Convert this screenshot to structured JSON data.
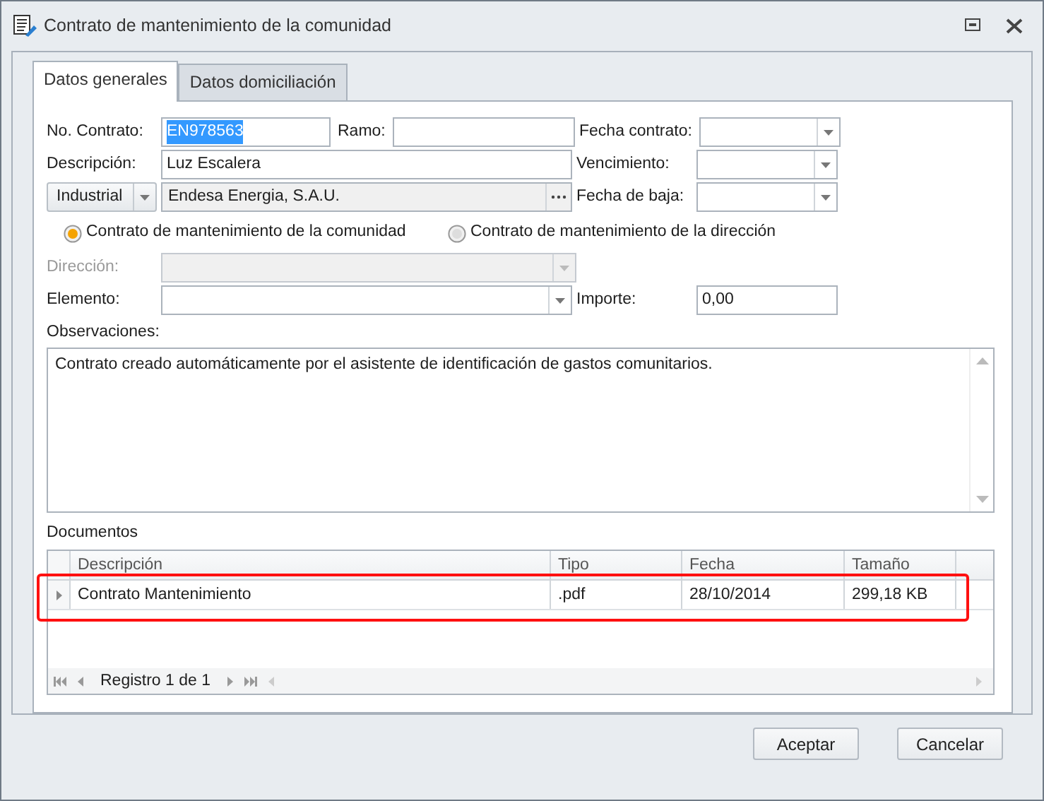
{
  "window": {
    "title": "Contrato de mantenimiento de la comunidad"
  },
  "tabs": [
    {
      "label": "Datos generales",
      "selected": true
    },
    {
      "label": "Datos domiciliación",
      "selected": false
    }
  ],
  "contrato": {
    "label": "No. Contrato:",
    "value": "EN978563",
    "text_selected": true
  },
  "ramo": {
    "label": "Ramo:"
  },
  "fecha_contrato": {
    "label": "Fecha contrato:"
  },
  "descripcion": {
    "label": "Descripción:",
    "value": "Luz Escalera"
  },
  "vencimiento": {
    "label": "Vencimiento:"
  },
  "tipo_proveedor": {
    "value": "Industrial"
  },
  "proveedor": {
    "value": "Endesa Energia, S.A.U."
  },
  "fecha_baja": {
    "label": "Fecha de baja:"
  },
  "ambito": [
    {
      "label": "Contrato de mantenimiento de la comunidad",
      "selected": true
    },
    {
      "label": "Contrato de mantenimiento de la dirección",
      "selected": false
    }
  ],
  "direccion": {
    "label": "Dirección:",
    "disabled": true
  },
  "elemento": {
    "label": "Elemento:",
    "disabled": false
  },
  "importe": {
    "label": "Importe:",
    "value": "0,00"
  },
  "observaciones": {
    "label": "Observaciones:",
    "value": "Contrato creado automáticamente por el asistente de identificación de gastos comunitarios."
  },
  "documentos": {
    "label": "Documentos",
    "columns": [
      "Descripción",
      "Tipo",
      "Fecha",
      "Tamaño"
    ],
    "rows": [
      {
        "cells": [
          "Contrato Mantenimiento",
          ".pdf",
          "28/10/2014",
          "299,18 KB"
        ],
        "highlighted": true
      }
    ],
    "navigator": "Registro 1 de 1"
  },
  "buttons": [
    "Aceptar",
    "Cancelar"
  ]
}
